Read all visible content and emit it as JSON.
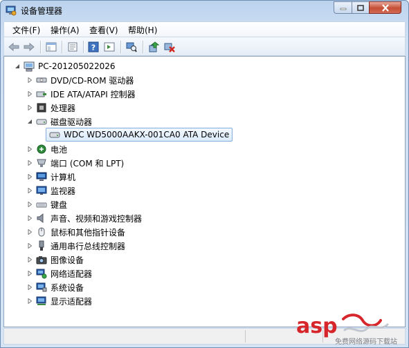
{
  "window": {
    "title": "设备管理器"
  },
  "menu": [
    {
      "label": "文件(F)"
    },
    {
      "label": "操作(A)"
    },
    {
      "label": "查看(V)"
    },
    {
      "label": "帮助(H)"
    }
  ],
  "toolbar": {
    "buttons": [
      {
        "icon": "back-arrow-icon"
      },
      {
        "icon": "forward-arrow-icon"
      },
      {
        "icon": "show-hide-console-tree-icon"
      },
      {
        "icon": "properties-icon"
      },
      {
        "icon": "help-icon"
      },
      {
        "icon": "action-pane-icon"
      },
      {
        "icon": "scan-hardware-changes-icon"
      },
      {
        "icon": "update-driver-icon"
      },
      {
        "icon": "uninstall-device-icon"
      }
    ]
  },
  "tree": {
    "root": "PC-201205022026",
    "items": [
      {
        "label": "DVD/CD-ROM 驱动器",
        "icon": "dvd-drive-icon",
        "state": "collapsed"
      },
      {
        "label": "IDE ATA/ATAPI 控制器",
        "icon": "ide-controller-icon",
        "state": "collapsed"
      },
      {
        "label": "处理器",
        "icon": "processor-icon",
        "state": "collapsed"
      },
      {
        "label": "磁盘驱动器",
        "icon": "disk-drive-icon",
        "state": "expanded",
        "children": [
          {
            "label": "WDC WD5000AAKX-001CA0 ATA Device",
            "icon": "hard-disk-icon",
            "selected": true
          }
        ]
      },
      {
        "label": "电池",
        "icon": "battery-icon",
        "state": "collapsed"
      },
      {
        "label": "端口 (COM 和 LPT)",
        "icon": "port-icon",
        "state": "collapsed"
      },
      {
        "label": "计算机",
        "icon": "computer-icon",
        "state": "collapsed"
      },
      {
        "label": "监视器",
        "icon": "monitor-icon",
        "state": "collapsed"
      },
      {
        "label": "键盘",
        "icon": "keyboard-icon",
        "state": "collapsed"
      },
      {
        "label": "声音、视频和游戏控制器",
        "icon": "sound-icon",
        "state": "collapsed"
      },
      {
        "label": "鼠标和其他指针设备",
        "icon": "mouse-icon",
        "state": "collapsed"
      },
      {
        "label": "通用串行总线控制器",
        "icon": "usb-icon",
        "state": "collapsed"
      },
      {
        "label": "图像设备",
        "icon": "imaging-device-icon",
        "state": "collapsed"
      },
      {
        "label": "网络适配器",
        "icon": "network-adapter-icon",
        "state": "collapsed"
      },
      {
        "label": "系统设备",
        "icon": "system-device-icon",
        "state": "collapsed"
      },
      {
        "label": "显示适配器",
        "icon": "display-adapter-icon",
        "state": "collapsed"
      }
    ]
  },
  "watermark": {
    "logo": "asp",
    "sub": "免费网络源码下载站"
  },
  "colors": {
    "selection_border": "#84acdd",
    "selection_fill": "#dcebfc",
    "title_gradient": "#c7daf1",
    "close_button": "#c64f37"
  }
}
